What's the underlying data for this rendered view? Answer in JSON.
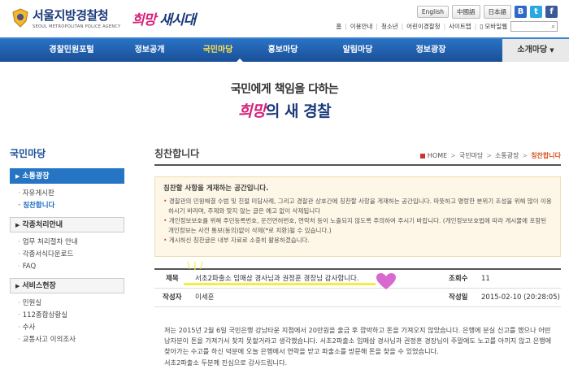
{
  "header": {
    "logo_main": "서울지방경찰청",
    "logo_sub": "SEOUL METROPOLITAN POLICE AGENCY",
    "slogan_hope": "희망",
    "slogan_rest": "새시대",
    "languages": [
      "English",
      "中國語",
      "日本語"
    ],
    "sns": [
      {
        "name": "blog-icon",
        "glyph": "B"
      },
      {
        "name": "twitter-icon",
        "glyph": "t"
      },
      {
        "name": "facebook-icon",
        "glyph": "f"
      }
    ],
    "utility_links": [
      "홈",
      "이용안내",
      "청소년",
      "어린이경찰청",
      "사이트맵",
      "모바일웹"
    ]
  },
  "nav": {
    "items": [
      "경찰민원포털",
      "정보공개",
      "국민마당",
      "홍보마당",
      "알림마당",
      "정보광장"
    ],
    "active_index": 2,
    "last": "소개마당"
  },
  "banner": {
    "line1": "국민에게 책임을 다하는",
    "line2_hope": "희망",
    "line2_rest": "의 새 경찰"
  },
  "sidebar": {
    "title": "국민마당",
    "cat1": "소통광장",
    "cat1_items": [
      "자유게시판",
      "칭찬합니다"
    ],
    "cat2": "각종처리안내",
    "cat2_items": [
      "업무 처리절차 안내",
      "각종서식다운로드",
      "FAQ"
    ],
    "cat3": "서비스현장",
    "cat3_items": [
      "민원실",
      "112종합상황실",
      "수사",
      "교통사고 이의조사"
    ]
  },
  "content": {
    "title": "칭찬합니다",
    "breadcrumb": [
      "HOME",
      "국민마당",
      "소통광장",
      "칭찬합니다"
    ],
    "notice_head": "칭찬할 사항을 게재하는 공간입니다.",
    "notice_lines": [
      "경찰관의 민원해결 수범 및 친절 미담사례, 그리고 경찰관 상호간에 칭찬할 사항을 게재하는 공간입니다. 따뜻하고 명랑한 분위기 조성을 위해 많이 이용하시기 바라며, 주제와 맞지 않는 글은 예고 없이 삭제됩니다",
      "개인정보보호를 위해 주민등록번호, 운전면허번호, 연락처 등이 노출되지 않도록 주의하여 주시기 바랍니다. (개인정보보호법에 따라 게시물에 포함된 개인정보는 사전 통보(동의)없이 삭제(*로 치환)될 수 있습니다.)",
      "게시하신 칭찬글은 내부 자료로 소중히 활용하겠습니다."
    ],
    "labels": {
      "subject": "제목",
      "views": "조회수",
      "author": "작성자",
      "date": "작성일"
    },
    "subject": "서초2파출소 임매삼 경사님과 권정훈 경장님 감사합니다.",
    "views": "11",
    "author": "이세훈",
    "date": "2015-02-10 (20:28:05)",
    "body": [
      "저는 2015년 2월 6일 국민은행 강남타운 지점에서 20만원을 출금 후 깜박하고 돈을 가져오지 않았습니다. 은행에 분실 신고를 했으나 어떤 남자분이 돈을 가져가서 찾지 못할거라고 생각했습니다. 서초2파출소 임매삼 경사님과 권정훈 경장님이 주말에도 노고를 아끼지 않고 은행에 찾아가는 수고를 하신 덕분에 오늘 은행에서 연락을 받고 파출소를 방문해 돈을 찾을 수 있었습니다.",
      "서초2파출소 두분께 진심으로 감사드립니다."
    ]
  },
  "colors": {
    "brand_blue": "#1a4f97",
    "nav_active": "#ffe14a",
    "breadcrumb_current": "#d9531e",
    "notice_bg": "#fef6e6",
    "highlight": "#f4ed42",
    "heart": "#d14fc6"
  }
}
